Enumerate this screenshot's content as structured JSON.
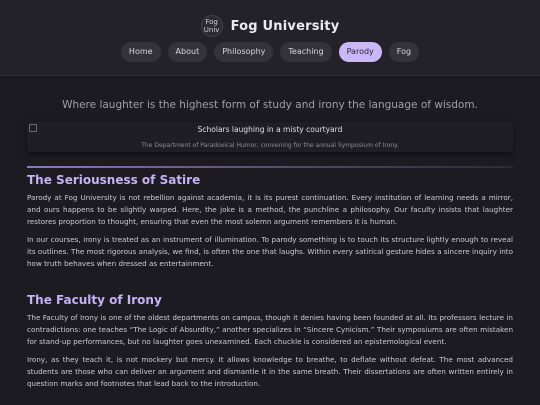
{
  "header": {
    "logo_alt": "Fog Univ",
    "title": "Fog University",
    "nav": [
      {
        "label": "Home"
      },
      {
        "label": "About"
      },
      {
        "label": "Philosophy"
      },
      {
        "label": "Teaching"
      },
      {
        "label": "Parody",
        "active": true
      },
      {
        "label": "Fog"
      }
    ]
  },
  "main": {
    "tagline": "Where laughter is the highest form of study and irony the language of wisdom.",
    "hero": {
      "alt": "Scholars laughing in a misty courtyard",
      "caption": "The Department of Paradoxical Humor, convening for the annual Symposium of Irony."
    },
    "sections": [
      {
        "title": "The Seriousness of Satire",
        "paragraphs": [
          "Parody at Fog University is not rebellion against academia, it is its purest continuation. Every institution of learning needs a mirror, and ours happens to be slightly warped. Here, the joke is a method, the punchline a philosophy. Our faculty insists that laughter restores proportion to thought, ensuring that even the most solemn argument remembers it is human.",
          "In our courses, irony is treated as an instrument of illumination. To parody something is to touch its structure lightly enough to reveal its outlines. The most rigorous analysis, we find, is often the one that laughs. Within every satirical gesture hides a sincere inquiry into how truth behaves when dressed as entertainment."
        ]
      },
      {
        "title": "The Faculty of Irony",
        "paragraphs": [
          "The Faculty of Irony is one of the oldest departments on campus, though it denies having been founded at all. Its professors lecture in contradictions: one teaches “The Logic of Absurdity,” another specializes in “Sincere Cynicism.” Their symposiums are often mistaken for stand-up performances, but no laughter goes unexamined. Each chuckle is considered an epistemological event.",
          "Irony, as they teach it, is not mockery but mercy. It allows knowledge to breathe, to deflate without defeat. The most advanced students are those who can deliver an argument and dismantle it in the same breath. Their dissertations are often written entirely in question marks and footnotes that lead back to the introduction."
        ]
      }
    ]
  },
  "colors": {
    "background": "#1c1b22",
    "accent": "#c4b2f4",
    "nav_active": "#c9b8f7"
  }
}
